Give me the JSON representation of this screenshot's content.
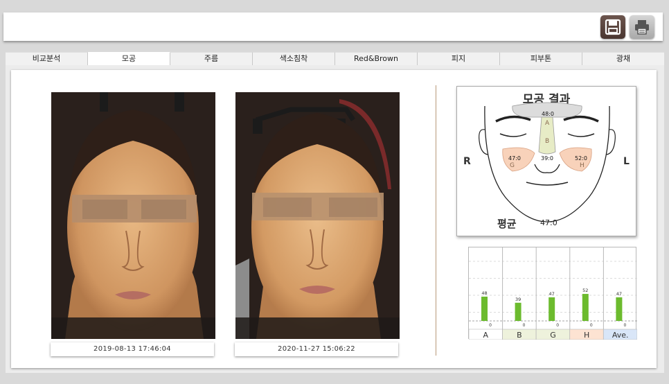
{
  "toolbar": {
    "save_icon": "save-icon",
    "print_icon": "printer-icon"
  },
  "tabs": [
    {
      "label": "비교분석",
      "active": false
    },
    {
      "label": "모공",
      "active": true
    },
    {
      "label": "주름",
      "active": false
    },
    {
      "label": "색소침착",
      "active": false
    },
    {
      "label": "Red&Brown",
      "active": false
    },
    {
      "label": "피지",
      "active": false
    },
    {
      "label": "피부톤",
      "active": false
    },
    {
      "label": "광채",
      "active": false
    }
  ],
  "photos": [
    {
      "date": "2019-08-13 17:46:04"
    },
    {
      "date": "2020-11-27 15:06:22"
    }
  ],
  "result": {
    "title": "모공 결과",
    "right_label": "R",
    "left_label": "L",
    "zones": [
      {
        "letter": "A",
        "value": "48:0"
      },
      {
        "letter": "B",
        "value": "39:0"
      },
      {
        "letter": "G",
        "value": "47:0"
      },
      {
        "letter": "H",
        "value": "52:0"
      }
    ],
    "average_label": "평균",
    "average_value": "47:0"
  },
  "chart_data": {
    "type": "bar",
    "categories": [
      "A",
      "B",
      "G",
      "H",
      "Ave."
    ],
    "series": [
      {
        "values": [
          48,
          39,
          47,
          52,
          47
        ]
      },
      {
        "values": [
          0,
          0,
          0,
          0,
          0
        ]
      }
    ],
    "data_labels": [
      "48",
      "39",
      "47",
      "52",
      "47"
    ],
    "zero_labels": [
      "0",
      "0",
      "0",
      "0",
      "0"
    ],
    "category_colors": [
      "#ffffff",
      "#eef2dc",
      "#eef2dc",
      "#fde3d2",
      "#d9e6f8"
    ],
    "bar_color": "#6cbb2e",
    "ylim": [
      0,
      100
    ]
  }
}
